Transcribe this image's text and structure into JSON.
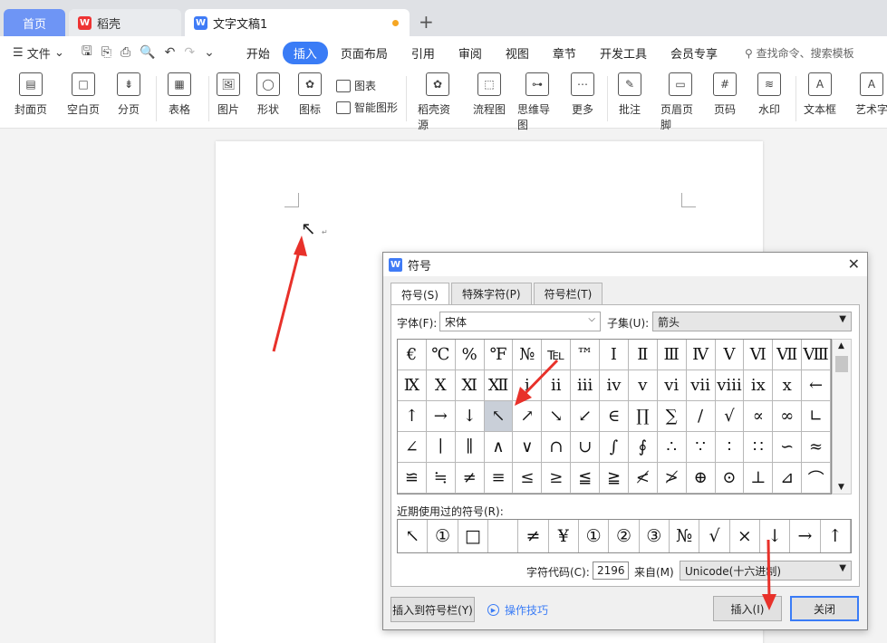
{
  "tabs": {
    "home": "首页",
    "wps": "稻壳",
    "doc": "文字文稿1"
  },
  "menubar": {
    "file": "文件",
    "items": [
      "开始",
      "插入",
      "页面布局",
      "引用",
      "审阅",
      "视图",
      "章节",
      "开发工具",
      "会员专享"
    ],
    "active": "插入",
    "search": "查找命令、搜索模板"
  },
  "ribbon": {
    "buttons": [
      "封面页",
      "空白页",
      "分页",
      "表格",
      "图片",
      "形状",
      "图标",
      "稻壳资源",
      "流程图",
      "思维导图",
      "更多",
      "批注",
      "页眉页脚",
      "页码",
      "水印",
      "文本框",
      "艺术字"
    ],
    "small": [
      "图表",
      "智能图形"
    ]
  },
  "document": {
    "arrow": "↖",
    "mark": "↵"
  },
  "dialog": {
    "title": "符号",
    "tabs": [
      "符号(S)",
      "特殊字符(P)",
      "符号栏(T)"
    ],
    "font_label": "字体(F):",
    "font_value": "宋体",
    "subset_label": "子集(U):",
    "subset_value": "箭头",
    "symbols": [
      "€",
      "℃",
      "%",
      "℉",
      "№",
      "℡",
      "™",
      "Ⅰ",
      "Ⅱ",
      "Ⅲ",
      "Ⅳ",
      "Ⅴ",
      "Ⅵ",
      "Ⅶ",
      "Ⅷ",
      "Ⅸ",
      "Ⅹ",
      "Ⅺ",
      "Ⅻ",
      "ⅰ",
      "ⅱ",
      "ⅲ",
      "ⅳ",
      "ⅴ",
      "ⅵ",
      "ⅶ",
      "ⅷ",
      "ⅸ",
      "ⅹ",
      "←",
      "↑",
      "→",
      "↓",
      "↖",
      "↗",
      "↘",
      "↙",
      "∈",
      "∏",
      "∑",
      "∕",
      "√",
      "∝",
      "∞",
      "∟",
      "∠",
      "∣",
      "∥",
      "∧",
      "∨",
      "∩",
      "∪",
      "∫",
      "∮",
      "∴",
      "∵",
      "∶",
      "∷",
      "∽",
      "≈",
      "≌",
      "≒",
      "≠",
      "≡",
      "≤",
      "≥",
      "≦",
      "≧",
      "≮",
      "≯",
      "⊕",
      "⊙",
      "⊥",
      "⊿",
      "⌒"
    ],
    "selected_index": 33,
    "recent_label": "近期使用过的符号(R):",
    "recent": [
      "↖",
      "①",
      "□",
      "",
      "≠",
      "¥",
      "①",
      "②",
      "③",
      "№",
      "√",
      "×",
      "↓",
      "→",
      "↑"
    ],
    "code_label": "字符代码(C):",
    "code_value": "2196",
    "from_label": "来自(M)",
    "from_value": "Unicode(十六进制)",
    "insert_bar_button": "插入到符号栏(Y)",
    "tips": "操作技巧",
    "insert_button": "插入(I)",
    "close_button": "关闭"
  },
  "colors": {
    "accent": "#3a7cf6",
    "annotation": "#e8312a"
  }
}
